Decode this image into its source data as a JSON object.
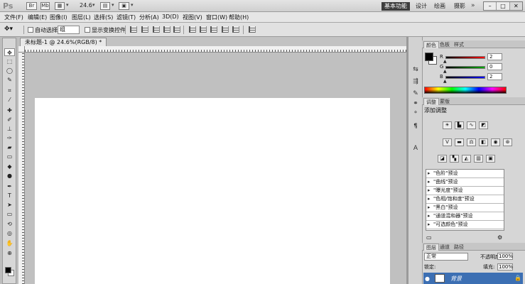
{
  "app": {
    "logo": "Ps",
    "zoom": "24.6",
    "workspace_active": "基本功能",
    "workspaces": [
      "设计",
      "绘画",
      "摄影"
    ],
    "window_buttons": [
      "–",
      "□",
      "✕"
    ]
  },
  "menu": [
    "文件(F)",
    "编辑(E)",
    "图像(I)",
    "图层(L)",
    "选择(S)",
    "滤镜(T)",
    "分析(A)",
    "3D(D)",
    "视图(V)",
    "窗口(W)",
    "帮助(H)"
  ],
  "options": {
    "tool_icon": "move-tool-icon",
    "auto_select_label": "自动选择:",
    "auto_select_value": "组",
    "show_transform_label": "显示变换控件"
  },
  "document": {
    "tab_title": "未标题-1 @ 24.6%(RGB/8) *"
  },
  "tools": [
    "move",
    "marquee",
    "lasso",
    "quick-select",
    "crop",
    "eyedropper",
    "healing",
    "brush",
    "clone-stamp",
    "history-brush",
    "eraser",
    "gradient",
    "blur",
    "dodge",
    "pen",
    "type",
    "path-select",
    "shape",
    "3d-rotate",
    "3d-orbit",
    "hand",
    "zoom"
  ],
  "panels": {
    "color_tabs": [
      "颜色",
      "色板",
      "样式"
    ],
    "channels": [
      {
        "label": "R",
        "value": "2"
      },
      {
        "label": "G",
        "value": "0"
      },
      {
        "label": "B",
        "value": "2"
      }
    ],
    "adjust_tabs": [
      "调整",
      "蒙版"
    ],
    "adjust_title": "添加调整",
    "presets": [
      "\"色阶\"预设",
      "\"曲线\"预设",
      "\"曝光度\"预设",
      "\"色相/饱和度\"预设",
      "\"黑白\"预设",
      "\"通道混和器\"预设",
      "\"可选颜色\"预设"
    ],
    "layers_tabs": [
      "图层",
      "通道",
      "路径"
    ],
    "blend_mode": "正常",
    "opacity_label": "不透明度:",
    "opacity_value": "100%",
    "lock_label": "锁定:",
    "fill_label": "填充:",
    "fill_value": "100%",
    "layer_name": "背景"
  }
}
